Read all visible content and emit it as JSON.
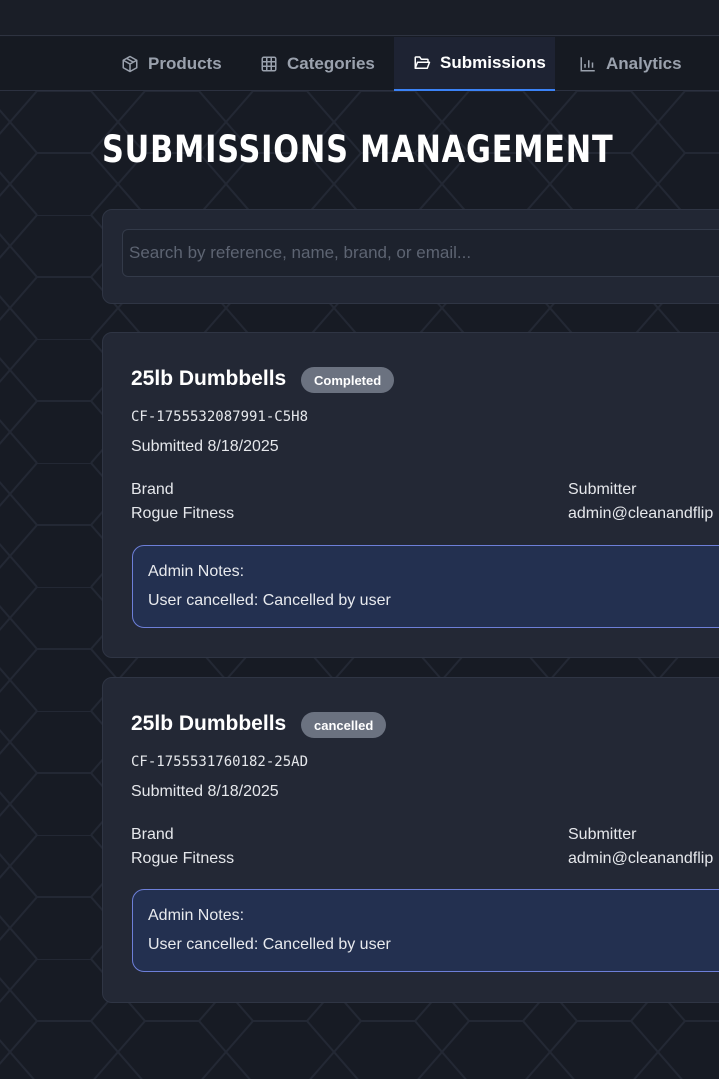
{
  "nav": {
    "tabs": [
      {
        "label": "Products",
        "icon": "box-icon",
        "active": false
      },
      {
        "label": "Categories",
        "icon": "grid-icon",
        "active": false
      },
      {
        "label": "Submissions",
        "icon": "folder-icon",
        "active": true
      },
      {
        "label": "Analytics",
        "icon": "bar-chart-icon",
        "active": false
      }
    ]
  },
  "page": {
    "title": "SUBMISSIONS MANAGEMENT"
  },
  "search": {
    "placeholder": "Search by reference, name, brand, or email...",
    "value": ""
  },
  "submissions": [
    {
      "title": "25lb Dumbbells",
      "status": "Completed",
      "reference": "CF-1755532087991-C5H8",
      "submitted": "Submitted 8/18/2025",
      "brand_label": "Brand",
      "brand": "Rogue Fitness",
      "submitter_label": "Submitter",
      "submitter": "admin@cleanandflip",
      "notes_label": "Admin Notes:",
      "notes": "User cancelled: Cancelled by user"
    },
    {
      "title": "25lb Dumbbells",
      "status": "cancelled",
      "reference": "CF-1755531760182-25AD",
      "submitted": "Submitted 8/18/2025",
      "brand_label": "Brand",
      "brand": "Rogue Fitness",
      "submitter_label": "Submitter",
      "submitter": "admin@cleanandflip",
      "notes_label": "Admin Notes:",
      "notes": "User cancelled: Cancelled by user"
    }
  ],
  "colors": {
    "background": "#171b24",
    "card": "#232835",
    "accent": "#3b82f6",
    "badge": "#6b7280",
    "notes_bg": "#233050",
    "notes_border": "#6d7fd8"
  }
}
